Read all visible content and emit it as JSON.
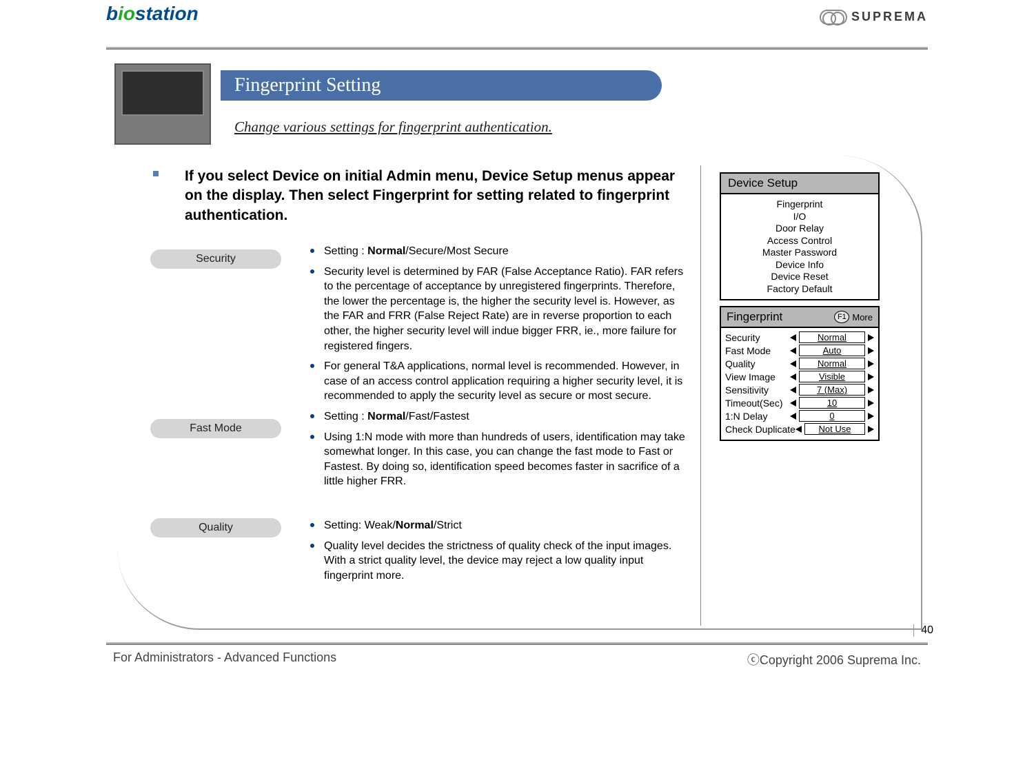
{
  "header": {
    "logo_left": "biostation",
    "logo_right": "SUPREMA"
  },
  "title": "Fingerprint Setting",
  "subtitle": "Change various settings for fingerprint authentication.",
  "lead": "If you select Device on initial Admin menu, Device Setup menus appear on the display. Then select Fingerprint for setting related to fingerprint authentication.",
  "sections": [
    {
      "pill": "Security",
      "bullets": [
        {
          "prefix": "Setting : ",
          "bold": "Normal",
          "suffix": "/Secure/Most Secure"
        },
        {
          "text": "Security level is determined by FAR (False Acceptance Ratio). FAR refers to the percentage of acceptance by unregistered fingerprints. Therefore, the lower the percentage is, the higher the security level is. However, as the FAR and FRR (False Reject Rate) are in reverse proportion to each other, the higher security level will indue bigger FRR, ie., more failure for registered fingers."
        },
        {
          "text": "For general T&A applications, normal level is recommended. However, in case of an access control application requiring a higher security level, it is recommended to apply the security level as secure or most secure."
        }
      ]
    },
    {
      "pill": "Fast Mode",
      "bullets": [
        {
          "prefix": "Setting : ",
          "bold": "Normal",
          "suffix": "/Fast/Fastest"
        },
        {
          "text": "Using 1:N mode with more than hundreds of users, identification may take somewhat longer. In this case, you can change the fast mode to Fast or Fastest. By doing so, identification speed becomes faster in sacrifice of a little higher FRR."
        }
      ]
    },
    {
      "pill": "Quality",
      "bullets": [
        {
          "prefix": "Setting: Weak/",
          "bold": "Normal",
          "suffix": "/Strict"
        },
        {
          "text": "Quality level decides the strictness of quality check of the input images. With a strict quality level, the device may reject a low quality input fingerprint more."
        }
      ]
    }
  ],
  "device_setup": {
    "title": "Device Setup",
    "items": [
      "Fingerprint",
      "I/O",
      "Door Relay",
      "Access Control",
      "Master Password",
      "Device Info",
      "Device Reset",
      "Factory Default"
    ]
  },
  "fingerprint_panel": {
    "title": "Fingerprint",
    "f1_label": "F1",
    "more_label": "More",
    "rows": [
      {
        "label": "Security",
        "value": "Normal"
      },
      {
        "label": "Fast Mode",
        "value": "Auto"
      },
      {
        "label": "Quality",
        "value": "Normal"
      },
      {
        "label": "View Image",
        "value": "Visible"
      },
      {
        "label": "Sensitivity",
        "value": "7 (Max)"
      },
      {
        "label": "Timeout(Sec)",
        "value": "10"
      },
      {
        "label": "1:N Delay",
        "value": "0"
      },
      {
        "label": "Check Duplicate",
        "value": "Not Use"
      }
    ]
  },
  "footer": {
    "page": "40",
    "left": "For Administrators - Advanced Functions",
    "right": "ⓒCopyright 2006 Suprema Inc."
  }
}
